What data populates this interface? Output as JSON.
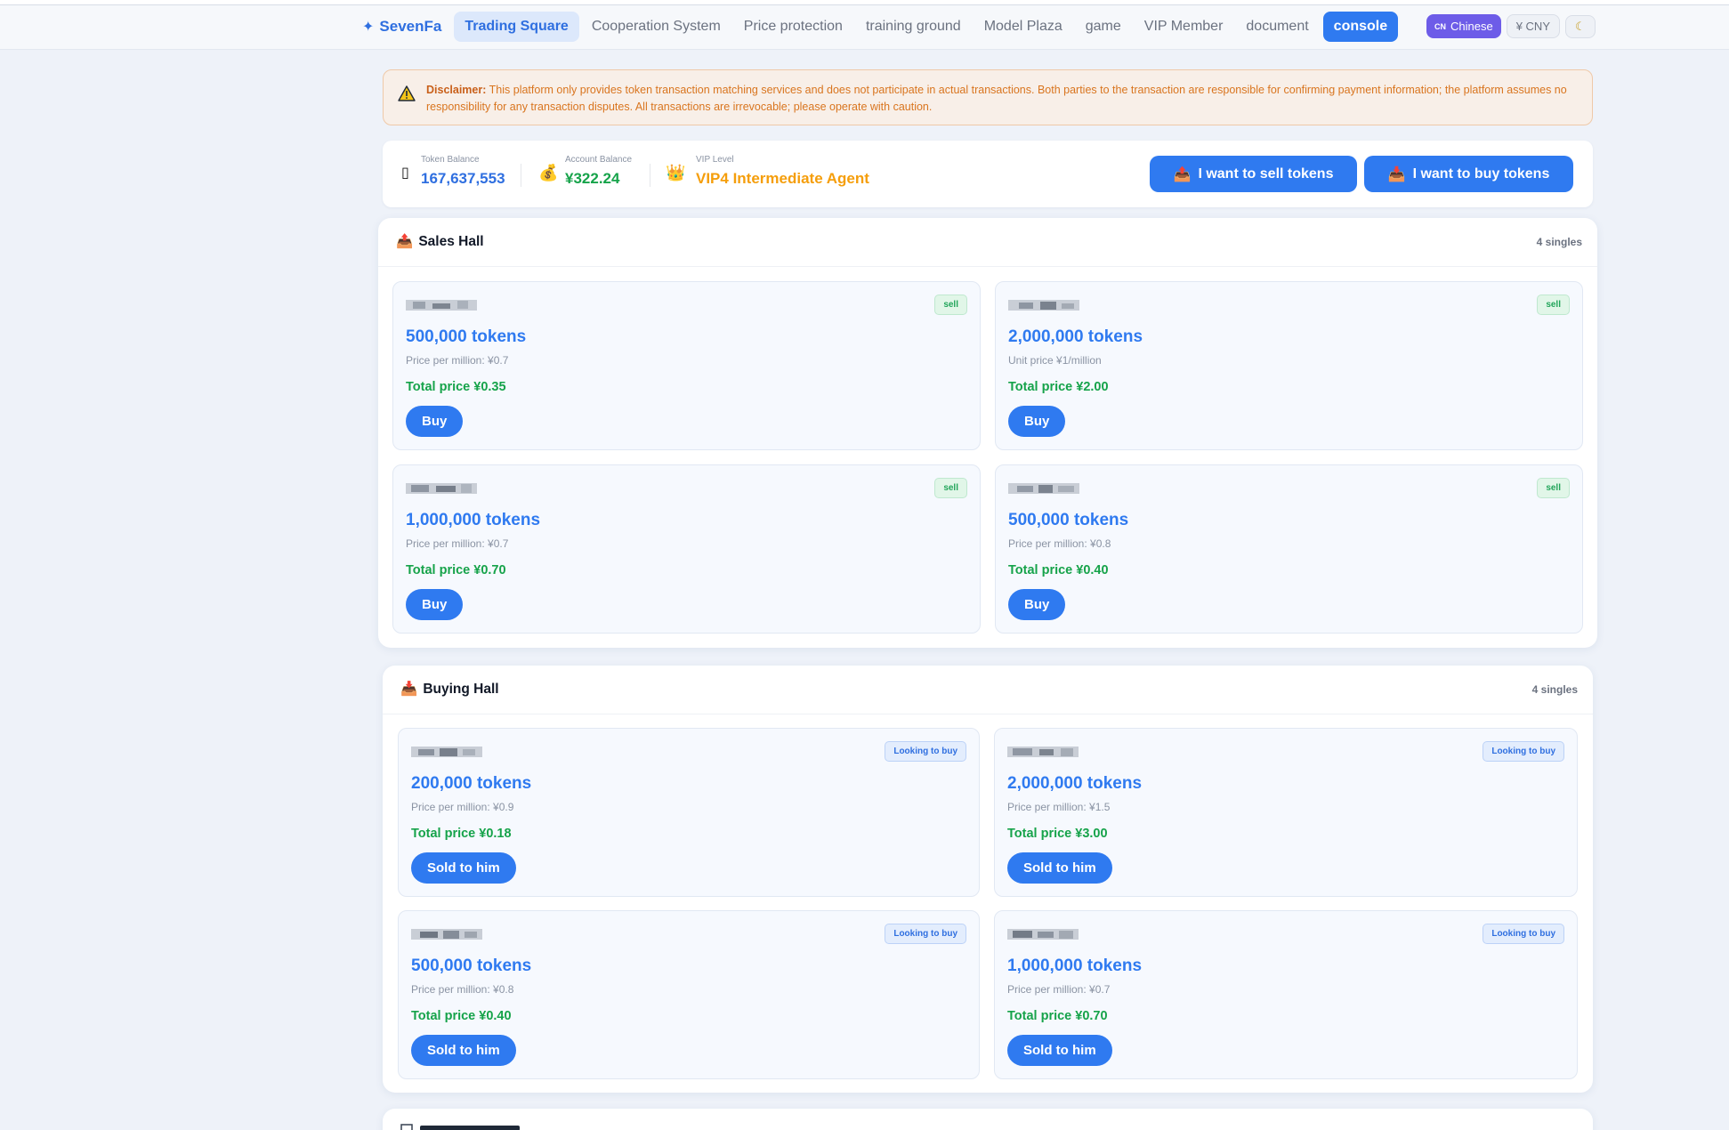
{
  "nav": {
    "brand": "SevenFa",
    "items": [
      {
        "label": "Trading Square",
        "active": true
      },
      {
        "label": "Cooperation System"
      },
      {
        "label": "Price protection"
      },
      {
        "label": "training ground"
      },
      {
        "label": "Model Plaza"
      },
      {
        "label": "game"
      },
      {
        "label": "VIP Member"
      },
      {
        "label": "document"
      }
    ],
    "console": "console",
    "language_flag": "CN",
    "language": "Chinese",
    "currency": "¥ CNY",
    "theme_icon": "moon-icon"
  },
  "disclaimer": {
    "label": "Disclaimer:",
    "text": "This platform only provides token transaction matching services and does not participate in actual transactions. Both parties to the transaction are responsible for confirming payment information; the platform assumes no responsibility for any transaction disputes. All transactions are irrevocable; please operate with caution."
  },
  "balances": {
    "token_label": "Token Balance",
    "token_value": "167,637,553",
    "account_label": "Account Balance",
    "account_value": "¥322.24",
    "vip_label": "VIP Level",
    "vip_value": "VIP4 Intermediate Agent",
    "sell_button": "I want to sell tokens",
    "buy_button": "I want to buy tokens"
  },
  "sales_hall": {
    "title": "Sales Hall",
    "count": "4 singles",
    "cards": [
      {
        "badge": "sell",
        "tokens": "500,000 tokens",
        "unit": "Price per million: ¥0.7",
        "total": "Total price ¥0.35",
        "action": "Buy"
      },
      {
        "badge": "sell",
        "tokens": "2,000,000 tokens",
        "unit": "Unit price ¥1/million",
        "total": "Total price ¥2.00",
        "action": "Buy"
      },
      {
        "badge": "sell",
        "tokens": "1,000,000 tokens",
        "unit": "Price per million: ¥0.7",
        "total": "Total price ¥0.70",
        "action": "Buy"
      },
      {
        "badge": "sell",
        "tokens": "500,000 tokens",
        "unit": "Price per million: ¥0.8",
        "total": "Total price ¥0.40",
        "action": "Buy"
      }
    ]
  },
  "buying_hall": {
    "title": "Buying Hall",
    "count": "4 singles",
    "cards": [
      {
        "badge": "Looking to buy",
        "tokens": "200,000 tokens",
        "unit": "Price per million: ¥0.9",
        "total": "Total price ¥0.18",
        "action": "Sold to him"
      },
      {
        "badge": "Looking to buy",
        "tokens": "2,000,000 tokens",
        "unit": "Price per million: ¥1.5",
        "total": "Total price ¥3.00",
        "action": "Sold to him"
      },
      {
        "badge": "Looking to buy",
        "tokens": "500,000 tokens",
        "unit": "Price per million: ¥0.8",
        "total": "Total price ¥0.40",
        "action": "Sold to him"
      },
      {
        "badge": "Looking to buy",
        "tokens": "1,000,000 tokens",
        "unit": "Price per million: ¥0.7",
        "total": "Total price ¥0.70",
        "action": "Sold to him"
      }
    ]
  },
  "colors": {
    "primary": "#2f7af0",
    "success": "#16a34a",
    "warning": "#d9751f",
    "vip": "#f59e0b"
  }
}
